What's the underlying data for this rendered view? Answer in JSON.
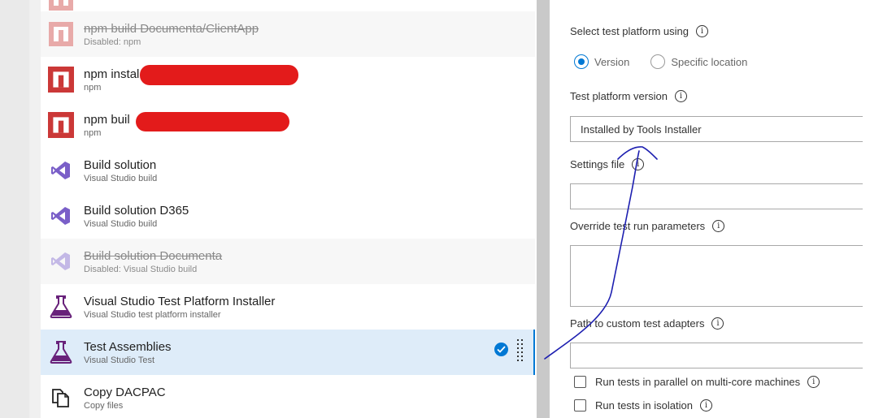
{
  "tasks": [
    {
      "title": "npm build Documenta/ClientApp",
      "subtitle": "Disabled: npm",
      "icon": "npm-icon",
      "disabled": true
    },
    {
      "title": "npm instal",
      "subtitle": "npm",
      "icon": "npm-icon",
      "disabled": false
    },
    {
      "title": "npm buil",
      "subtitle": "npm",
      "icon": "npm-icon",
      "disabled": false
    },
    {
      "title": "Build solution",
      "subtitle": "Visual Studio build",
      "icon": "visual-studio-icon",
      "disabled": false
    },
    {
      "title": "Build solution D365",
      "subtitle": "Visual Studio build",
      "icon": "visual-studio-icon",
      "disabled": false
    },
    {
      "title": "Build solution Documenta",
      "subtitle": "Disabled: Visual Studio build",
      "icon": "visual-studio-icon",
      "disabled": true
    },
    {
      "title": "Visual Studio Test Platform Installer",
      "subtitle": "Visual Studio test platform installer",
      "icon": "flask-icon",
      "disabled": false
    },
    {
      "title": "Test Assemblies",
      "subtitle": "Visual Studio Test",
      "icon": "flask-icon",
      "disabled": false,
      "selected": true
    },
    {
      "title": "Copy DACPAC",
      "subtitle": "Copy files",
      "icon": "copy-files-icon",
      "disabled": false
    }
  ],
  "options": {
    "platform_label": "Select test platform using",
    "radio_version": "Version",
    "radio_location": "Specific location",
    "version_label": "Test platform version",
    "version_value": "Installed by Tools Installer",
    "settings_label": "Settings file",
    "settings_value": "",
    "override_label": "Override test run parameters",
    "override_value": "",
    "adapters_label": "Path to custom test adapters",
    "adapters_value": "",
    "parallel_label": "Run tests in parallel on multi-core machines",
    "isolation_label": "Run tests in isolation"
  },
  "colors": {
    "npm_red": "#cb3837",
    "vs_purple": "#7a5fc8",
    "accent_blue": "#0078d4",
    "redaction_red": "#e31b1b",
    "ink_blue": "#1d1fb0"
  }
}
